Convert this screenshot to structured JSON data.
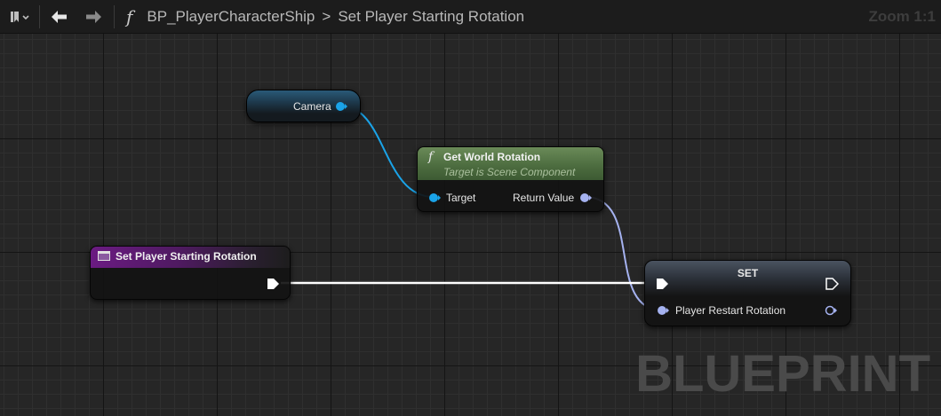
{
  "toolbar": {
    "breadcrumb_blueprint": "BP_PlayerCharacterShip",
    "breadcrumb_separator": ">",
    "breadcrumb_function": "Set Player Starting Rotation",
    "function_glyph": "f",
    "zoom": "Zoom 1:1",
    "icons": [
      "bookmark-icon",
      "chevron-down-icon",
      "back-arrow-icon",
      "forward-arrow-icon"
    ]
  },
  "nodes": {
    "camera": {
      "output_label": "Camera"
    },
    "get_world_rotation": {
      "title": "Get World Rotation",
      "subtitle": "Target is Scene Component",
      "input_label": "Target",
      "output_label": "Return Value"
    },
    "event": {
      "title": "Set Player Starting Rotation"
    },
    "set": {
      "title": "SET",
      "input_label": "Player Restart Rotation"
    }
  },
  "watermark": "BLUEPRINT",
  "colors": {
    "object_pin": "#1aa3e8",
    "rotator_pin": "#a5b2f0",
    "exec_pin": "#ffffff",
    "function_header": "#4b6b3e",
    "event_header": "#6b1b82",
    "background": "#262626"
  }
}
